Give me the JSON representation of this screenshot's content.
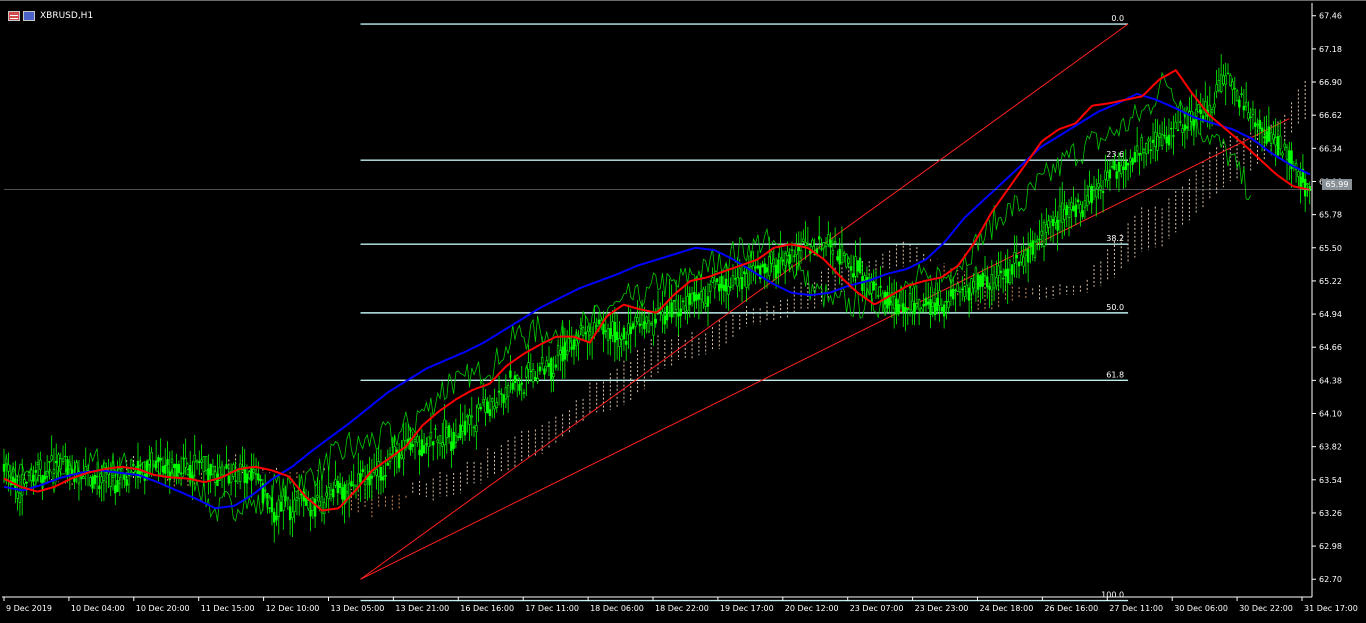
{
  "header": {
    "symbol": "XBRUSD,H1",
    "icons": [
      "table-icon",
      "window-icon"
    ]
  },
  "current_price": "65.99",
  "colors": {
    "background": "#000000",
    "candles": "#00ff00",
    "fast_ma": "#ff0000",
    "slow_ma": "#0000ff",
    "chikou": "#00cc00",
    "cloud_up": "#ffe4c4",
    "cloud_down": "#f4a460",
    "fib": "#bfefef",
    "trend": "#ff2020",
    "axis_text": "#ffffff"
  },
  "chart_data": {
    "type": "candlestick",
    "symbol": "XBRUSD",
    "timeframe": "H1",
    "x_labels": [
      "9 Dec 2019",
      "10 Dec 04:00",
      "10 Dec 20:00",
      "11 Dec 15:00",
      "12 Dec 10:00",
      "13 Dec 05:00",
      "13 Dec 21:00",
      "16 Dec 16:00",
      "17 Dec 11:00",
      "18 Dec 06:00",
      "18 Dec 22:00",
      "19 Dec 17:00",
      "20 Dec 12:00",
      "23 Dec 07:00",
      "23 Dec 23:00",
      "24 Dec 18:00",
      "26 Dec 16:00",
      "27 Dec 11:00",
      "30 Dec 06:00",
      "30 Dec 22:00",
      "31 Dec 17:00"
    ],
    "y_labels": [
      "67.46",
      "67.18",
      "66.90",
      "66.62",
      "66.34",
      "66.06",
      "65.78",
      "65.50",
      "65.22",
      "64.94",
      "64.66",
      "64.38",
      "64.10",
      "63.82",
      "63.54",
      "63.26",
      "62.98",
      "62.70"
    ],
    "y_range": [
      62.55,
      67.5
    ],
    "current_price": 65.99,
    "fibonacci": {
      "levels": [
        {
          "label": "0.0",
          "price": 67.39
        },
        {
          "label": "23.6",
          "price": 66.24
        },
        {
          "label": "38.2",
          "price": 65.53
        },
        {
          "label": "50.0",
          "price": 64.95
        },
        {
          "label": "61.8",
          "price": 64.38
        },
        {
          "label": "100.0",
          "price": 62.52
        }
      ],
      "anchor_low": {
        "bar": 157,
        "price": 62.7
      },
      "anchor_high": {
        "bar": 495,
        "price": 67.39
      }
    },
    "trend_lines": [
      {
        "from": {
          "bar": 157,
          "price": 62.7
        },
        "to": {
          "bar": 495,
          "price": 67.39
        }
      },
      {
        "from": {
          "bar": 157,
          "price": 62.7
        },
        "to": {
          "bar": 566,
          "price": 66.59
        }
      }
    ],
    "series": [
      {
        "name": "Close",
        "values": [
          63.54,
          63.62,
          63.5,
          63.41,
          63.44,
          63.53,
          63.52,
          63.62,
          63.6,
          63.61,
          63.61,
          63.67,
          63.66,
          63.73,
          63.67,
          63.66,
          63.64,
          63.6,
          63.58,
          63.62,
          63.57,
          63.57,
          63.56,
          63.52,
          63.53,
          63.58,
          63.53,
          63.52,
          63.53,
          63.54,
          63.57,
          63.58,
          63.67,
          63.62,
          63.63,
          63.63,
          63.65,
          63.69,
          63.71,
          63.67,
          63.68,
          63.62,
          63.67,
          63.67,
          63.67,
          63.66,
          63.65,
          63.64,
          63.69,
          63.69,
          63.66,
          63.62,
          63.58,
          63.58,
          63.56,
          63.6,
          63.55,
          63.61,
          63.57,
          63.6,
          63.59,
          63.59,
          63.54,
          63.56,
          63.46,
          63.39,
          63.34,
          63.27,
          63.28,
          63.28,
          63.36,
          63.31,
          63.27,
          63.35,
          63.37,
          63.38,
          63.33,
          63.32,
          63.32,
          63.31,
          63.35,
          63.41,
          63.49,
          63.48,
          63.49,
          63.41,
          63.49,
          63.5,
          63.51,
          63.57,
          63.52,
          63.58,
          63.59,
          63.61,
          63.62,
          63.64,
          63.75,
          63.74,
          63.74,
          63.71,
          63.82,
          63.85,
          63.79,
          63.81,
          63.83,
          63.86,
          63.86,
          63.9,
          63.86,
          63.86,
          63.97,
          63.91,
          63.87,
          63.93,
          63.94,
          64.0,
          64.03,
          63.98,
          64.09,
          64.12,
          64.12,
          64.16,
          64.19,
          64.26,
          64.33,
          64.25,
          64.42,
          64.37,
          64.39,
          64.31,
          64.38,
          64.44,
          64.4,
          64.43,
          64.47,
          64.5,
          64.53,
          64.46,
          64.57,
          64.64,
          64.62,
          64.7,
          64.73,
          64.77,
          64.78,
          64.75,
          64.78,
          64.77,
          64.82,
          64.81,
          64.76,
          64.79,
          64.82,
          64.72,
          64.77,
          64.75,
          64.8,
          64.8,
          64.83,
          64.85,
          64.86,
          64.79,
          64.87,
          64.97,
          64.88,
          64.95,
          65.02,
          64.98,
          65.01,
          65.01,
          65.02,
          65.11,
          65.05,
          65.07,
          65.11,
          65.06,
          65.12,
          65.18,
          65.22,
          65.22,
          65.17,
          65.19,
          65.18,
          65.17,
          65.26,
          65.23,
          65.28,
          65.3,
          65.28,
          65.3,
          65.31,
          65.36,
          65.42,
          65.32,
          65.43,
          65.4,
          65.42,
          65.47,
          65.44,
          65.52,
          65.48,
          65.52,
          65.49,
          65.55,
          65.55,
          65.55,
          65.52,
          65.49,
          65.47,
          65.43,
          65.39,
          65.37,
          65.3,
          65.39,
          65.23,
          65.24,
          65.17,
          65.13,
          65.12,
          65.1,
          65.09,
          65.01,
          65.05,
          65.0,
          65.07,
          65.03,
          65.02,
          65.01,
          65.01,
          65.02,
          65.07,
          64.99,
          65.03,
          65.03,
          65.05,
          65.0,
          65.09,
          65.11,
          65.16,
          65.14,
          65.14,
          65.15,
          65.17,
          65.26,
          65.2,
          65.24,
          65.19,
          65.21,
          65.3,
          65.22,
          65.27,
          65.27,
          65.38,
          65.38,
          65.39,
          65.43,
          65.49,
          65.48,
          65.59,
          65.56,
          65.64,
          65.66,
          65.74,
          65.71,
          65.81,
          65.81,
          65.81,
          65.85,
          65.86,
          65.84,
          65.91,
          65.96,
          65.98,
          66.05,
          66.04,
          66.1,
          66.11,
          66.18,
          66.17,
          66.22,
          66.24,
          66.28,
          66.3,
          66.31,
          66.33,
          66.36,
          66.4,
          66.38,
          66.4,
          66.42,
          66.44,
          66.46,
          66.48,
          66.51,
          66.52,
          66.54,
          66.57,
          66.6,
          66.61,
          66.64,
          66.67,
          66.71,
          66.79,
          66.83,
          66.89,
          66.9,
          66.88,
          66.82,
          66.77,
          66.72,
          66.67,
          66.61,
          66.57,
          66.52,
          66.49,
          66.47,
          66.44,
          66.41,
          66.38,
          66.33,
          66.3,
          66.25,
          66.2,
          66.12,
          66.08,
          66.02,
          65.99
        ]
      },
      {
        "name": "MA-fast",
        "values": [
          63.55,
          63.48,
          63.44,
          63.48,
          63.55,
          63.6,
          63.63,
          63.65,
          63.63,
          63.58,
          63.56,
          63.55,
          63.52,
          63.56,
          63.63,
          63.65,
          63.62,
          63.57,
          63.4,
          63.28,
          63.3,
          63.45,
          63.62,
          63.72,
          63.82,
          64.0,
          64.12,
          64.22,
          64.3,
          64.35,
          64.5,
          64.6,
          64.68,
          64.75,
          64.75,
          64.7,
          64.92,
          65.02,
          64.98,
          64.95,
          65.1,
          65.22,
          65.25,
          65.3,
          65.35,
          65.4,
          65.5,
          65.53,
          65.5,
          65.4,
          65.25,
          65.12,
          65.02,
          65.1,
          65.18,
          65.22,
          65.25,
          65.35,
          65.55,
          65.8,
          66.0,
          66.2,
          66.4,
          66.5,
          66.55,
          66.7,
          66.72,
          66.75,
          66.78,
          66.92,
          67.0,
          66.8,
          66.62,
          66.5,
          66.38,
          66.25,
          66.12,
          66.02,
          65.99
        ]
      },
      {
        "name": "MA-slow",
        "values": [
          63.48,
          63.45,
          63.5,
          63.56,
          63.6,
          63.62,
          63.6,
          63.58,
          63.52,
          63.45,
          63.38,
          63.3,
          63.32,
          63.42,
          63.55,
          63.65,
          63.78,
          63.9,
          64.02,
          64.15,
          64.28,
          64.38,
          64.48,
          64.55,
          64.62,
          64.7,
          64.8,
          64.9,
          65.0,
          65.08,
          65.16,
          65.22,
          65.28,
          65.35,
          65.4,
          65.45,
          65.5,
          65.48,
          65.4,
          65.3,
          65.2,
          65.12,
          65.1,
          65.12,
          65.18,
          65.22,
          65.28,
          65.32,
          65.4,
          65.55,
          65.75,
          65.9,
          66.05,
          66.2,
          66.35,
          66.45,
          66.55,
          66.65,
          66.72,
          66.8,
          66.75,
          66.68,
          66.6,
          66.55,
          66.5,
          66.42,
          66.3,
          66.2,
          66.12
        ]
      }
    ]
  }
}
